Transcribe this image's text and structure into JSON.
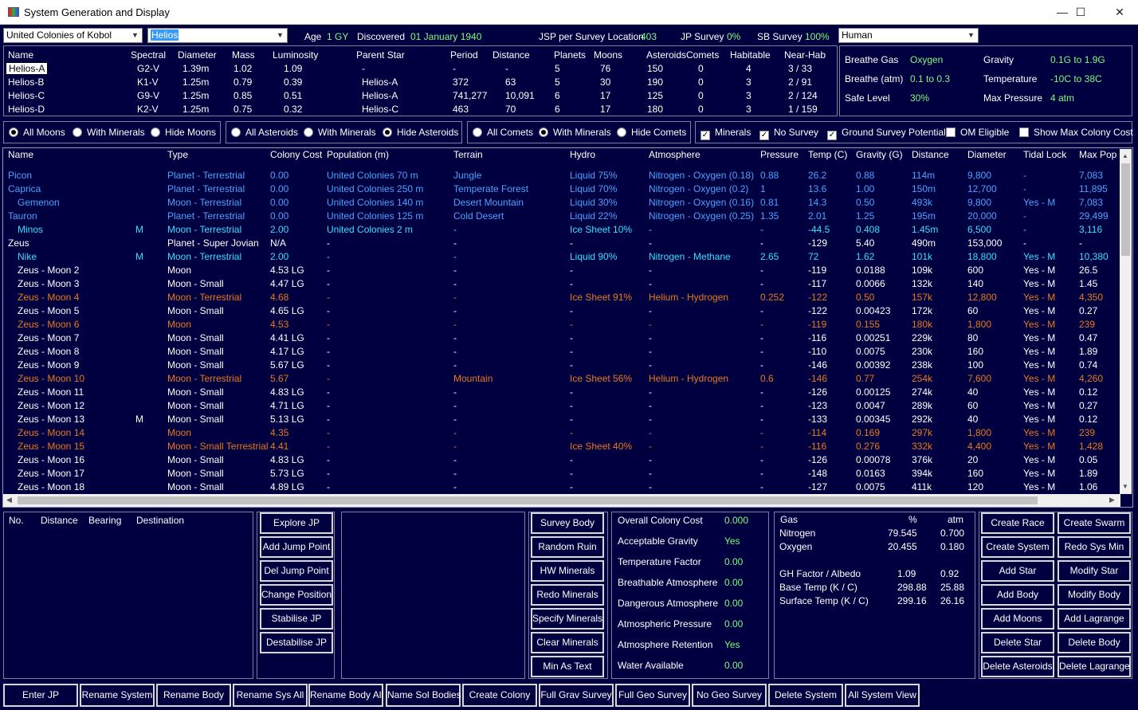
{
  "window": {
    "title": "System Generation and Display",
    "minimize": "—",
    "maximize": "☐",
    "close": "✕"
  },
  "top": {
    "race": "United Colonies of Kobol",
    "system": "Helios",
    "age_label": "Age",
    "age": "1 GY",
    "discovered_label": "Discovered",
    "discovered": "01 January 1940",
    "jsp_label": "JSP per Survey Location",
    "jsp": "403",
    "jp_survey_label": "JP Survey",
    "jp_survey": "0%",
    "sb_survey_label": "SB Survey",
    "sb_survey": "100%",
    "species": "Human"
  },
  "stars": {
    "headers": [
      "Name",
      "Spectral",
      "Diameter",
      "Mass",
      "Luminosity",
      "Parent Star",
      "Period",
      "Distance",
      "Planets",
      "Moons",
      "Asteroids",
      "Comets",
      "Habitable",
      "Near-Hab"
    ],
    "rows": [
      [
        "Helios-A",
        "G2-V",
        "1.39m",
        "1.02",
        "1.09",
        "-",
        "-",
        "-",
        "5",
        "76",
        "150",
        "0",
        "4",
        "3 / 33"
      ],
      [
        "Helios-B",
        "K1-V",
        "1.25m",
        "0.79",
        "0.39",
        "Helios-A",
        "372",
        "63",
        "5",
        "30",
        "190",
        "0",
        "3",
        "2 / 91"
      ],
      [
        "Helios-C",
        "G9-V",
        "1.25m",
        "0.85",
        "0.51",
        "Helios-A",
        "741,277",
        "10,091",
        "6",
        "17",
        "125",
        "0",
        "3",
        "2 / 124"
      ],
      [
        "Helios-D",
        "K2-V",
        "1.25m",
        "0.75",
        "0.32",
        "Helios-C",
        "463",
        "70",
        "6",
        "17",
        "180",
        "0",
        "3",
        "1 / 159"
      ]
    ]
  },
  "env": {
    "breathe_gas_label": "Breathe Gas",
    "breathe_gas": "Oxygen",
    "gravity_label": "Gravity",
    "gravity": "0.1G  to  1.9G",
    "breathe_atm_label": "Breathe (atm)",
    "breathe_atm": "0.1  to  0.3",
    "temperature_label": "Temperature",
    "temperature": "-10C  to  38C",
    "safe_level_label": "Safe Level",
    "safe_level": "30%",
    "max_pressure_label": "Max Pressure",
    "max_pressure": "4 atm"
  },
  "filters": {
    "moons": [
      "All Moons",
      "With Minerals",
      "Hide Moons"
    ],
    "asteroids": [
      "All Asteroids",
      "With Minerals",
      "Hide Asteroids"
    ],
    "comets": [
      "All Comets",
      "With Minerals",
      "Hide Comets"
    ],
    "checks": [
      "Minerals",
      "No Survey",
      "Ground Survey Potential",
      "OM Eligible",
      "Show Max Colony Cost"
    ],
    "check_mark": "✓"
  },
  "bodies": {
    "headers": [
      "Name",
      "Type",
      "Colony Cost",
      "Population (m)",
      "Terrain",
      "Hydro",
      "Atmosphere",
      "Pressure",
      "Temp (C)",
      "Gravity (G)",
      "Distance",
      "Diameter",
      "Tidal Lock",
      "Max Pop"
    ],
    "rows": [
      {
        "c": "blue",
        "v": [
          "Picon",
          "",
          "Planet - Terrestrial",
          "0.00",
          "United Colonies 70 m",
          "Jungle",
          "Liquid 75%",
          "Nitrogen - Oxygen (0.18)",
          "0.88",
          "26.2",
          "0.88",
          "114m",
          "9,800",
          "-",
          "7,083"
        ]
      },
      {
        "c": "blue",
        "v": [
          "Caprica",
          "",
          "Planet - Terrestrial",
          "0.00",
          "United Colonies 250 m",
          "Temperate Forest",
          "Liquid 70%",
          "Nitrogen - Oxygen (0.2)",
          "1",
          "13.6",
          "1.00",
          "150m",
          "12,700",
          "-",
          "11,895"
        ]
      },
      {
        "c": "blue",
        "v": [
          "Gemenon",
          "",
          "Moon - Terrestrial",
          "0.00",
          "United Colonies 140 m",
          "Desert Mountain",
          "Liquid 30%",
          "Nitrogen - Oxygen (0.16)",
          "0.81",
          "14.3",
          "0.50",
          "493k",
          "9,800",
          "Yes - M",
          "7,083"
        ]
      },
      {
        "c": "blue",
        "v": [
          "Tauron",
          "",
          "Planet - Terrestrial",
          "0.00",
          "United Colonies 125 m",
          "Cold Desert",
          "Liquid 22%",
          "Nitrogen - Oxygen (0.25)",
          "1.35",
          "2.01",
          "1.25",
          "195m",
          "20,000",
          "-",
          "29,499"
        ]
      },
      {
        "c": "cyan",
        "v": [
          "Minos",
          "M",
          "Moon - Terrestrial",
          "2.00",
          "United Colonies 2 m",
          "-",
          "Ice Sheet 10%",
          "-",
          "-",
          "-44.5",
          "0.408",
          "1.45m",
          "6,500",
          "-",
          "3,116"
        ]
      },
      {
        "c": "white",
        "v": [
          "Zeus",
          "",
          "Planet - Super Jovian",
          "N/A",
          "-",
          "-",
          "-",
          "-",
          "-",
          "-129",
          "5.40",
          "490m",
          "153,000",
          "-",
          "-"
        ]
      },
      {
        "c": "cyan",
        "v": [
          "Nike",
          "M",
          "Moon - Terrestrial",
          "2.00",
          "-",
          "-",
          "Liquid 90%",
          "Nitrogen - Methane",
          "2.65",
          "72",
          "1.62",
          "101k",
          "18,800",
          "Yes - M",
          "10,380"
        ]
      },
      {
        "c": "white",
        "v": [
          "Zeus - Moon 2",
          "",
          "Moon",
          "4.53 LG",
          "-",
          "-",
          "-",
          "-",
          "-",
          "-119",
          "0.0188",
          "109k",
          "600",
          "Yes - M",
          "26.5"
        ]
      },
      {
        "c": "white",
        "v": [
          "Zeus - Moon 3",
          "",
          "Moon - Small",
          "4.47 LG",
          "-",
          "-",
          "-",
          "-",
          "-",
          "-117",
          "0.0066",
          "132k",
          "140",
          "Yes - M",
          "1.45"
        ]
      },
      {
        "c": "orange",
        "v": [
          "Zeus - Moon 4",
          "",
          "Moon - Terrestrial",
          "4.68",
          "-",
          "-",
          "Ice Sheet 91%",
          "Helium - Hydrogen",
          "0.252",
          "-122",
          "0.50",
          "157k",
          "12,800",
          "Yes - M",
          "4,350"
        ]
      },
      {
        "c": "white",
        "v": [
          "Zeus - Moon 5",
          "",
          "Moon - Small",
          "4.65 LG",
          "-",
          "-",
          "-",
          "-",
          "-",
          "-122",
          "0.00423",
          "172k",
          "60",
          "Yes - M",
          "0.27"
        ]
      },
      {
        "c": "orange",
        "v": [
          "Zeus - Moon 6",
          "",
          "Moon",
          "4.53",
          "-",
          "-",
          "-",
          "-",
          "-",
          "-119",
          "0.155",
          "180k",
          "1,800",
          "Yes - M",
          "239"
        ]
      },
      {
        "c": "white",
        "v": [
          "Zeus - Moon 7",
          "",
          "Moon - Small",
          "4.41 LG",
          "-",
          "-",
          "-",
          "-",
          "-",
          "-116",
          "0.00251",
          "229k",
          "80",
          "Yes - M",
          "0.47"
        ]
      },
      {
        "c": "white",
        "v": [
          "Zeus - Moon 8",
          "",
          "Moon - Small",
          "4.17 LG",
          "-",
          "-",
          "-",
          "-",
          "-",
          "-110",
          "0.0075",
          "230k",
          "160",
          "Yes - M",
          "1.89"
        ]
      },
      {
        "c": "white",
        "v": [
          "Zeus - Moon 9",
          "",
          "Moon - Small",
          "5.67 LG",
          "-",
          "-",
          "-",
          "-",
          "-",
          "-146",
          "0.00392",
          "238k",
          "100",
          "Yes - M",
          "0.74"
        ]
      },
      {
        "c": "orange",
        "v": [
          "Zeus - Moon 10",
          "",
          "Moon - Terrestrial",
          "5.67",
          "-",
          "Mountain",
          "Ice Sheet 56%",
          "Helium - Hydrogen",
          "0.6",
          "-146",
          "0.77",
          "254k",
          "7,600",
          "Yes - M",
          "4,260"
        ]
      },
      {
        "c": "white",
        "v": [
          "Zeus - Moon 11",
          "",
          "Moon - Small",
          "4.83 LG",
          "-",
          "-",
          "-",
          "-",
          "-",
          "-126",
          "0.00125",
          "274k",
          "40",
          "Yes - M",
          "0.12"
        ]
      },
      {
        "c": "white",
        "v": [
          "Zeus - Moon 12",
          "",
          "Moon - Small",
          "4.71 LG",
          "-",
          "-",
          "-",
          "-",
          "-",
          "-123",
          "0.0047",
          "289k",
          "60",
          "Yes - M",
          "0.27"
        ]
      },
      {
        "c": "white",
        "v": [
          "Zeus - Moon 13",
          "M",
          "Moon - Small",
          "5.13 LG",
          "-",
          "-",
          "-",
          "-",
          "-",
          "-133",
          "0.00345",
          "292k",
          "40",
          "Yes - M",
          "0.12"
        ]
      },
      {
        "c": "orange",
        "v": [
          "Zeus - Moon 14",
          "",
          "Moon",
          "4.35",
          "-",
          "-",
          "-",
          "-",
          "-",
          "-114",
          "0.169",
          "297k",
          "1,800",
          "Yes - M",
          "239"
        ]
      },
      {
        "c": "orange",
        "v": [
          "Zeus - Moon 15",
          "",
          "Moon - Small Terrestrial",
          "4.41",
          "-",
          "-",
          "Ice Sheet 40%",
          "-",
          "-",
          "-116",
          "0.276",
          "332k",
          "4,400",
          "Yes - M",
          "1,428"
        ]
      },
      {
        "c": "white",
        "v": [
          "Zeus - Moon 16",
          "",
          "Moon - Small",
          "4.83 LG",
          "-",
          "-",
          "-",
          "-",
          "-",
          "-126",
          "0.00078",
          "376k",
          "20",
          "Yes - M",
          "0.05"
        ]
      },
      {
        "c": "white",
        "v": [
          "Zeus - Moon 17",
          "",
          "Moon - Small",
          "5.73 LG",
          "-",
          "-",
          "-",
          "-",
          "-",
          "-148",
          "0.0163",
          "394k",
          "160",
          "Yes - M",
          "1.89"
        ]
      },
      {
        "c": "white",
        "v": [
          "Zeus - Moon 18",
          "",
          "Moon - Small",
          "4.89 LG",
          "-",
          "-",
          "-",
          "-",
          "-",
          "-127",
          "0.0075",
          "411k",
          "120",
          "Yes - M",
          "1.06"
        ]
      }
    ]
  },
  "jp": {
    "headers": [
      "No.",
      "Distance",
      "Bearing",
      "Destination"
    ]
  },
  "jp_buttons": [
    "Explore JP",
    "Add Jump Point",
    "Del Jump Point",
    "Change Position",
    "Stabilise JP",
    "Destabilise JP"
  ],
  "survey_buttons": [
    "Survey Body",
    "Random Ruin",
    "HW Minerals",
    "Redo Minerals",
    "Specify Minerals",
    "Clear Minerals",
    "Min As Text"
  ],
  "colony": [
    [
      "Overall Colony Cost",
      "0.000"
    ],
    [
      "Acceptable Gravity",
      "Yes"
    ],
    [
      "Temperature Factor",
      "0.00"
    ],
    [
      "Breathable Atmosphere",
      "0.00"
    ],
    [
      "Dangerous Atmosphere",
      "0.00"
    ],
    [
      "Atmospheric Pressure",
      "0.00"
    ],
    [
      "Atmosphere Retention",
      "Yes"
    ],
    [
      "Water Available",
      "0.00"
    ]
  ],
  "gas": {
    "headers": [
      "Gas",
      "%",
      "atm"
    ],
    "rows": [
      [
        "Nitrogen",
        "79.545",
        "0.700"
      ],
      [
        "Oxygen",
        "20.455",
        "0.180"
      ]
    ],
    "factors": [
      [
        "GH Factor / Albedo",
        "1.09",
        "0.92"
      ],
      [
        "Base Temp (K / C)",
        "298.88",
        "25.88"
      ],
      [
        "Surface Temp (K / C)",
        "299.16",
        "26.16"
      ]
    ]
  },
  "right_buttons": [
    [
      "Create Race",
      "Create Swarm"
    ],
    [
      "Create System",
      "Redo Sys Min"
    ],
    [
      "Add Star",
      "Modify Star"
    ],
    [
      "Add Body",
      "Modify Body"
    ],
    [
      "Add Moons",
      "Add Lagrange"
    ],
    [
      "Delete Star",
      "Delete Body"
    ],
    [
      "Delete Asteroids",
      "Delete Lagrange"
    ]
  ],
  "bottom_buttons": [
    "Enter JP",
    "Rename System",
    "Rename Body",
    "Rename Sys All",
    "Rename Body All",
    "Name Sol Bodies",
    "Create Colony",
    "Full Grav Survey",
    "Full Geo Survey",
    "No Geo Survey",
    "Delete System",
    "All System View"
  ],
  "colors": {
    "background": "#000040",
    "planet_blue": "#4aa3ff",
    "cyan": "#33e0ff",
    "orange": "#e8781e",
    "value_green": "#7cfc7c"
  }
}
